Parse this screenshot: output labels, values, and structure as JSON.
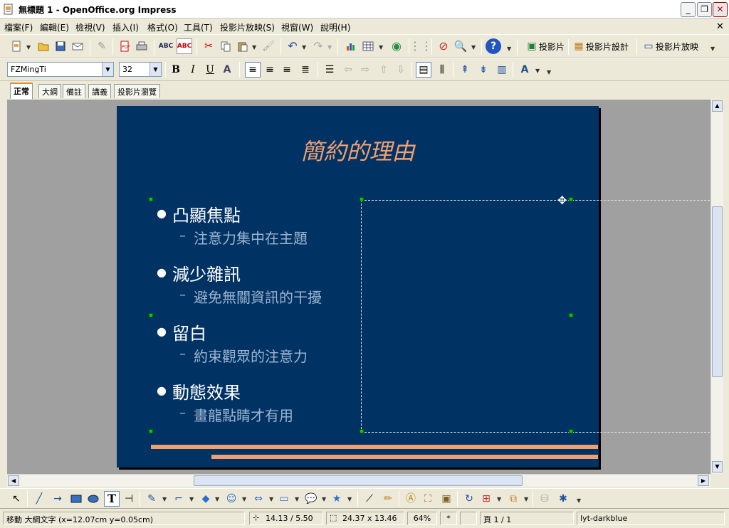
{
  "window": {
    "title": "無標題 1 - OpenOffice.org Impress"
  },
  "menu": [
    "檔案(F)",
    "編輯(E)",
    "檢視(V)",
    "插入(I)",
    "格式(O)",
    "工具(T)",
    "投影片放映(S)",
    "視窗(W)",
    "說明(H)"
  ],
  "toolbar": {
    "slide_label": "投影片",
    "slide_design_label": "投影片設計",
    "slideshow_label": "投影片放映"
  },
  "format": {
    "font": "FZMingTi",
    "size": "32"
  },
  "view_tabs": [
    "正常",
    "大綱",
    "備註",
    "講義",
    "投影片瀏覽"
  ],
  "slide": {
    "title": "簡約的理由",
    "bullets": [
      {
        "main": "凸顯焦點",
        "sub": "注意力集中在主題"
      },
      {
        "main": "減少雜訊",
        "sub": "避免無關資訊的干擾"
      },
      {
        "main": "留白",
        "sub": "約束觀眾的注意力"
      },
      {
        "main": "動態效果",
        "sub": "畫龍點睛才有用"
      }
    ],
    "colors": {
      "background": "#013264",
      "title": "#f0a070",
      "accent": "#f0a070"
    }
  },
  "status": {
    "action": "移動 大綱文字 (x=12.07cm y=0.05cm)",
    "position": "14.13 / 5.50",
    "size": "24.37 x 13.46",
    "zoom": "64%",
    "modified": "*",
    "page": "頁 1 / 1",
    "layout": "lyt-darkblue"
  }
}
